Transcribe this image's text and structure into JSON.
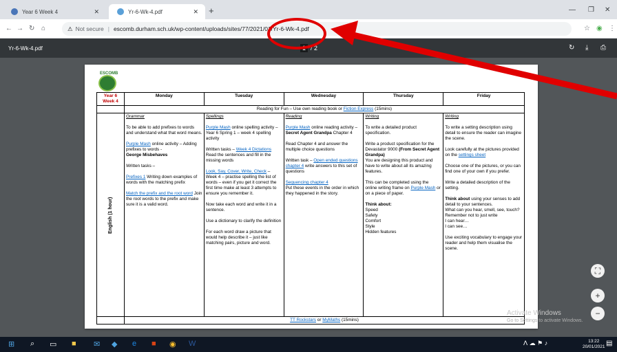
{
  "tabs": [
    {
      "label": "Year 6 Week 4"
    },
    {
      "label": "Yr-6-Wk-4.pdf"
    }
  ],
  "address": {
    "not_secure": "Not secure",
    "url": "escomb.durham.sch.uk/wp-content/uploads/sites/77/2021/01/Yr-6-Wk-4.pdf"
  },
  "pdf": {
    "title": "Yr-6-Wk-4.pdf",
    "page": "1",
    "total": "/ 2"
  },
  "doc": {
    "logo_text": "ESCOMB",
    "year": "Year 6",
    "week": "Week 4",
    "days": [
      "Monday",
      "Tuesday",
      "Wednesday",
      "Thursday",
      "Friday"
    ],
    "reading_pre": "Reading for Fun – Use own reading book or",
    "reading_link": "Fiction Express",
    "reading_post": "(15mins)",
    "subject": "English (1 hour)",
    "mon": {
      "head": "Grammar",
      "p1": "To be able to add prefixes to words and understand what that word means.",
      "link1": "Purple Mash",
      "p2": "online activity – Adding prefixes to words -",
      "p2b": "George Misbehaves",
      "p3": "Written tasks –",
      "link2": "Prefixes 1",
      "p4": "Writing down examples of words with the matching prefix",
      "link3": "Match the prefix and the root word",
      "p5": "Join the root words to the prefix and make sure it is a valid word."
    },
    "tue": {
      "head": "Spellings",
      "link1": "Purple Mash",
      "p1": "online spelling activity – Year 6 Spring 1 – week 4 spelling activity",
      "p2": "Written tasks –",
      "link2": "Week 4 Dictations",
      "p3": "Read the sentences and fill in the missing words",
      "link3": "Look, Say, Cover, Write, Check",
      "p4": "– Week 4 – practise spelling the list of words – even if you get it correct the first time make at least 3 attempts to ensure you remember it.",
      "p5": "Now take each word and write it in a sentence.",
      "p6": "Use a dictionary to clarify the definition",
      "p7": "For each word draw a picture that would help describe it – just like matching pairs, picture and word."
    },
    "wed": {
      "head": "Reading",
      "link1": "Purple Mash",
      "p1": "online reading activity –",
      "p1b": "Secret Agent Grandpa",
      "p1c": "Chapter 4",
      "p2": "Read Chapter 4 and answer the multiple choice questions",
      "p3": "Written task –",
      "link2": "Open ended questions chapter 4",
      "p4": "write answers to this set of questions",
      "link3": "Sequencing chapter 4",
      "p5": "Put these events in the order in which they happened in the story."
    },
    "thu": {
      "head": "Writing",
      "p1": "To write a detailed product specification.",
      "p2": "Write a product specification for the Devastator 9000",
      "p2b": "(From Secret Agent Grandpa)",
      "p3": "You are designing this product and have to write about all its amazing features.",
      "p4": "This can be completed using the online writing frame on",
      "link1": "Purple Mash",
      "p5": "or on a piece of paper.",
      "think": "Think about:",
      "list": [
        "Speed",
        "Safety",
        "Comfort",
        "Style",
        "Hidden features"
      ]
    },
    "fri": {
      "head": "Writing",
      "p1": "To write a setting description using detail to ensure the reader can imagine the scene.",
      "p2": "Look carefully at the pictures provided on the",
      "link1": "settings sheet",
      "p3": "Choose one of the pictures, or you can find one of your own if you prefer.",
      "p4": "Write a detailed description of the setting.",
      "p5b": "Think about",
      "p5": "using your senses to add detail to your sentences.",
      "p6": "What can you hear, smell, see, touch?",
      "p7": "Remember not to just write",
      "p8": "I can hear…",
      "p9": "I can see…",
      "p10": "Use exciting vocabulary to engage your reader and help them visualise the scene."
    },
    "maths_link1": "TT Rockstars",
    "maths_or": "or",
    "maths_link2": "MyMaths",
    "maths_post": "(15mins)"
  },
  "overlay": {
    "activate": "Activate Windows",
    "activate_sub": "Go to Settings to activate Windows."
  },
  "clock": {
    "time": "13:22",
    "date": "20/01/2021"
  }
}
